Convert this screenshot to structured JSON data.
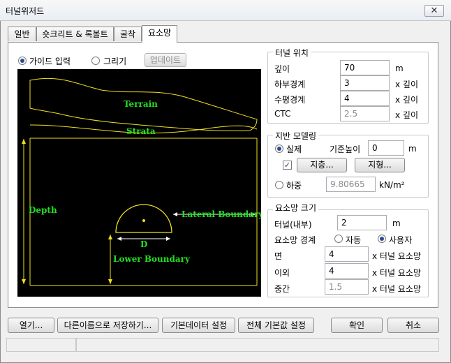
{
  "window": {
    "title": "터널위저드",
    "close_symbol": "✕"
  },
  "tabs": [
    {
      "label": "일반",
      "active": false
    },
    {
      "label": "숏크리트 & 록볼트",
      "active": false
    },
    {
      "label": "굴착",
      "active": false
    },
    {
      "label": "요소망",
      "active": true
    }
  ],
  "mode": {
    "guide_label": "가이드 입력",
    "draw_label": "그리기",
    "update_label": "업데이트",
    "selected": "guide"
  },
  "canvas": {
    "terrain_label": "Terrain",
    "strata_label": "Strata",
    "depth_label": "Depth",
    "lateral_label": "Lateral Boundary",
    "diameter_label": "D",
    "lower_label": "Lower Boundary",
    "colors": {
      "background": "#000000",
      "lines": "#f0e020",
      "labels": "#22e022",
      "guide": "#ffffff"
    }
  },
  "tunnel_position": {
    "title": "터널 위치",
    "depth": {
      "label": "깊이",
      "value": "70",
      "unit": "m"
    },
    "lower": {
      "label": "하부경계",
      "value": "3",
      "unit": "x 깊이"
    },
    "horizontal": {
      "label": "수평경계",
      "value": "4",
      "unit": "x 깊이"
    },
    "ctc": {
      "label": "CTC",
      "value": "2.5",
      "unit": "x 깊이"
    }
  },
  "ground_modeling": {
    "title": "지반 모델링",
    "actual_label": "실제",
    "ref_height_label": "기준높이",
    "ref_height_value": "0",
    "ref_height_unit": "m",
    "strata_checked": true,
    "strata_button": "지층...",
    "terrain_button": "지형...",
    "load_label": "하중",
    "load_value": "9.80665",
    "load_unit": "kN/m²",
    "selected": "actual"
  },
  "mesh_size": {
    "title": "요소망 크기",
    "tunnel_inner": {
      "label": "터널(내부)",
      "value": "2",
      "unit": "m"
    },
    "boundary_label": "요소망 경계",
    "auto_label": "자동",
    "user_label": "사용자",
    "boundary_selected": "user",
    "face": {
      "label": "면",
      "value": "4",
      "unit": "x 터널 요소망"
    },
    "other": {
      "label": "이외",
      "value": "4",
      "unit": "x 터널 요소망"
    },
    "middle": {
      "label": "중간",
      "value": "1.5",
      "unit": "x 터널 요소망"
    }
  },
  "footer": {
    "open": "열기...",
    "save_as": "다른이름으로 저장하기...",
    "default_settings": "기본데이터 설정",
    "all_defaults": "전체 기본값 설정",
    "ok": "확인",
    "cancel": "취소"
  }
}
